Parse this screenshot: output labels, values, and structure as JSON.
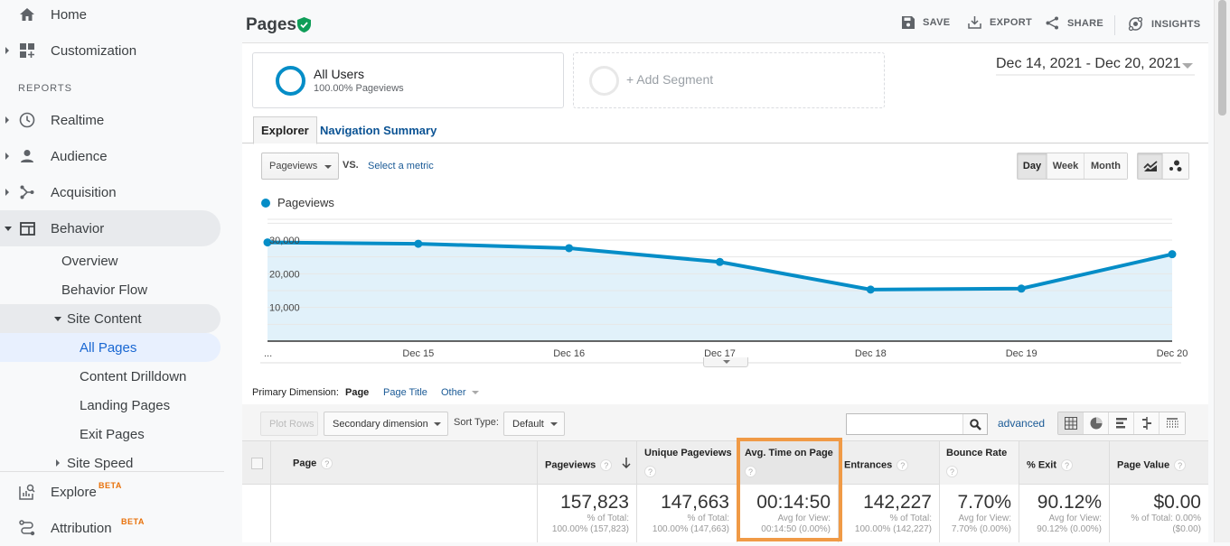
{
  "sidebar": {
    "home": "Home",
    "customization": "Customization",
    "reports_label": "REPORTS",
    "realtime": "Realtime",
    "audience": "Audience",
    "acquisition": "Acquisition",
    "behavior": "Behavior",
    "behavior_children": {
      "overview": "Overview",
      "behavior_flow": "Behavior Flow",
      "site_content": "Site Content",
      "all_pages": "All Pages",
      "content_drilldown": "Content Drilldown",
      "landing_pages": "Landing Pages",
      "exit_pages": "Exit Pages",
      "site_speed": "Site Speed"
    },
    "explore": "Explore",
    "attribution": "Attribution",
    "beta_badge": "BETA"
  },
  "header": {
    "title": "Pages",
    "save": "SAVE",
    "export": "EXPORT",
    "share": "SHARE",
    "insights": "INSIGHTS"
  },
  "segments": {
    "active_name": "All Users",
    "active_sub": "100.00% Pageviews",
    "add_label": "+ Add Segment"
  },
  "date_range": "Dec 14, 2021 - Dec 20, 2021",
  "tabs": {
    "explorer": "Explorer",
    "nav_summary": "Navigation Summary"
  },
  "metric": {
    "selected": "Pageviews",
    "vs": "VS.",
    "select_metric": "Select a metric"
  },
  "granularity": {
    "day": "Day",
    "week": "Week",
    "month": "Month",
    "active": "Day"
  },
  "chart_data": {
    "type": "area",
    "series": [
      {
        "name": "Pageviews",
        "color": "#058dc7",
        "values": [
          29300,
          28900,
          27600,
          23500,
          15300,
          15600,
          25800
        ]
      }
    ],
    "categories": [
      "Dec 14",
      "Dec 15",
      "Dec 16",
      "Dec 17",
      "Dec 18",
      "Dec 19",
      "Dec 20"
    ],
    "x_tick_labels": [
      "...",
      "Dec 15",
      "Dec 16",
      "Dec 17",
      "Dec 18",
      "Dec 19",
      "Dec 20"
    ],
    "y_ticks": [
      10000,
      20000,
      30000
    ],
    "y_tick_labels": [
      "10,000",
      "20,000",
      "30,000"
    ],
    "ylim": [
      0,
      30000
    ],
    "grid": true,
    "legend": "top-left"
  },
  "dimension": {
    "label": "Primary Dimension:",
    "page": "Page",
    "page_title": "Page Title",
    "other": "Other"
  },
  "toolbar": {
    "plot_rows": "Plot Rows",
    "secondary": "Secondary dimension",
    "sort_type_label": "Sort Type:",
    "sort_type_value": "Default",
    "search_value": "",
    "advanced": "advanced"
  },
  "table": {
    "columns": [
      {
        "label": "Page"
      },
      {
        "label": "Pageviews"
      },
      {
        "label": "Unique Pageviews"
      },
      {
        "label": "Avg. Time on Page"
      },
      {
        "label": "Entrances"
      },
      {
        "label": "Bounce Rate"
      },
      {
        "label": "% Exit"
      },
      {
        "label": "Page Value"
      }
    ],
    "totals": [
      {
        "value": "157,823",
        "sub1": "% of Total:",
        "sub2": "100.00% (157,823)"
      },
      {
        "value": "147,663",
        "sub1": "% of Total:",
        "sub2": "100.00% (147,663)"
      },
      {
        "value": "00:14:50",
        "sub1": "Avg for View:",
        "sub2": "00:14:50 (0.00%)"
      },
      {
        "value": "142,227",
        "sub1": "% of Total:",
        "sub2": "100.00% (142,227)"
      },
      {
        "value": "7.70%",
        "sub1": "Avg for View:",
        "sub2": "7.70% (0.00%)"
      },
      {
        "value": "90.12%",
        "sub1": "Avg for View:",
        "sub2": "90.12% (0.00%)"
      },
      {
        "value": "$0.00",
        "sub1": "% of Total: 0.00%",
        "sub2": "($0.00)"
      }
    ]
  },
  "colors": {
    "accent": "#058dc7",
    "highlight": "#f09a46",
    "beta": "#e8710a",
    "active_nav": "#1967d2"
  }
}
